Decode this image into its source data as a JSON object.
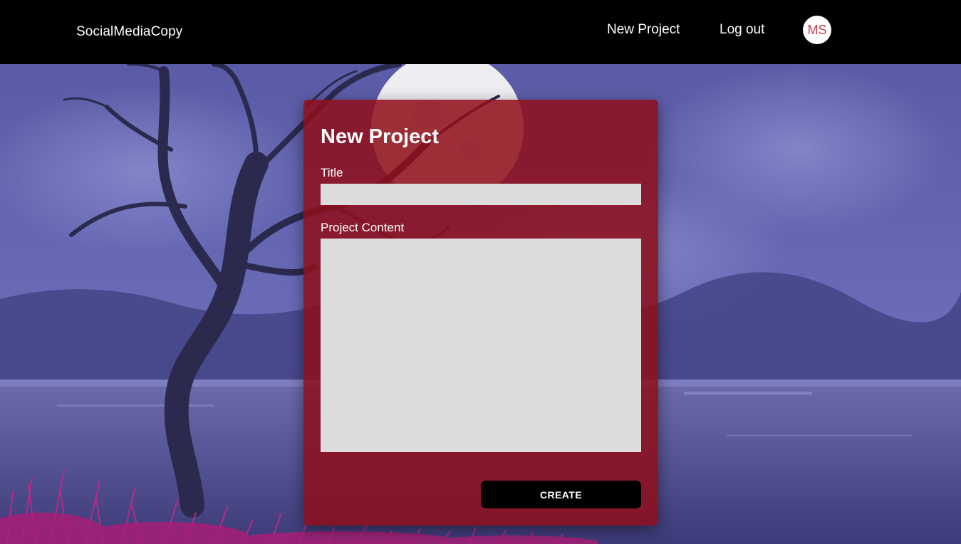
{
  "navbar": {
    "brand": "SocialMediaCopy",
    "links": {
      "new_project": "New Project",
      "log_out": "Log out"
    },
    "avatar_initials": "MS"
  },
  "form": {
    "heading": "New Project",
    "title_label": "Title",
    "title_value": "",
    "content_label": "Project Content",
    "content_value": "",
    "submit_label": "CREATE"
  },
  "colors": {
    "navbar_bg": "#000000",
    "card_bg": "#8f0e1a",
    "input_bg": "#dcdcdc",
    "button_bg": "#000000",
    "avatar_text": "#c9434e",
    "sky": "#5d5ea8"
  }
}
